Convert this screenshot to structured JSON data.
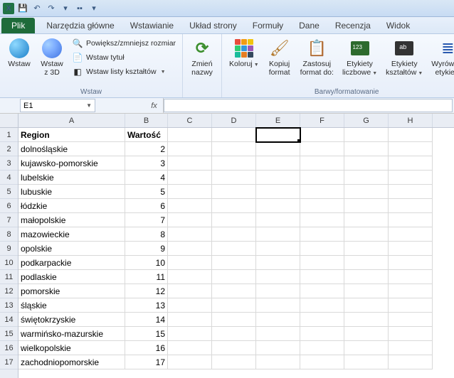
{
  "qat": {
    "save": "💾",
    "undo": "↶",
    "redo": "↷"
  },
  "tabs": {
    "file": "Plik",
    "items": [
      "Narzędzia główne",
      "Wstawianie",
      "Układ strony",
      "Formuły",
      "Dane",
      "Recenzja",
      "Widok"
    ]
  },
  "ribbon": {
    "grp_insert": {
      "label": "Wstaw",
      "insert": "Wstaw",
      "insert3d": "Wstaw\nz 3D",
      "resize": "Powiększ/zmniejsz rozmiar",
      "title": "Wstaw tytuł",
      "shapelist": "Wstaw listy kształtów"
    },
    "grp_names": {
      "change": "Zmień\nnazwy"
    },
    "grp_format": {
      "label": "Barwy/formatowanie",
      "color": "Koloruj",
      "copy": "Kopiuj\nformat",
      "apply": "Zastosuj\nformat do:",
      "numlabels": "Etykiety\nliczbowe",
      "shapelabels": "Etykiety\nkształtów",
      "align": "Wyrównaj\netykiety"
    }
  },
  "namebox": "E1",
  "fx": "fx",
  "columns": [
    "A",
    "B",
    "C",
    "D",
    "E",
    "F",
    "G",
    "H"
  ],
  "rows": [
    "1",
    "2",
    "3",
    "4",
    "5",
    "6",
    "7",
    "8",
    "9",
    "10",
    "11",
    "12",
    "13",
    "14",
    "15",
    "16",
    "17"
  ],
  "headers": {
    "c0": "Region",
    "c1": "Wartość"
  },
  "data": [
    {
      "region": "dolnośląskie",
      "val": "2"
    },
    {
      "region": "kujawsko-pomorskie",
      "val": "3"
    },
    {
      "region": "lubelskie",
      "val": "4"
    },
    {
      "region": "lubuskie",
      "val": "5"
    },
    {
      "region": "łódzkie",
      "val": "6"
    },
    {
      "region": "małopolskie",
      "val": "7"
    },
    {
      "region": "mazowieckie",
      "val": "8"
    },
    {
      "region": "opolskie",
      "val": "9"
    },
    {
      "region": "podkarpackie",
      "val": "10"
    },
    {
      "region": "podlaskie",
      "val": "11"
    },
    {
      "region": "pomorskie",
      "val": "12"
    },
    {
      "region": "śląskie",
      "val": "13"
    },
    {
      "region": "świętokrzyskie",
      "val": "14"
    },
    {
      "region": "warmińsko-mazurskie",
      "val": "15"
    },
    {
      "region": "wielkopolskie",
      "val": "16"
    },
    {
      "region": "zachodniopomorskie",
      "val": "17"
    }
  ],
  "selected": {
    "row": 0,
    "col": "E"
  }
}
